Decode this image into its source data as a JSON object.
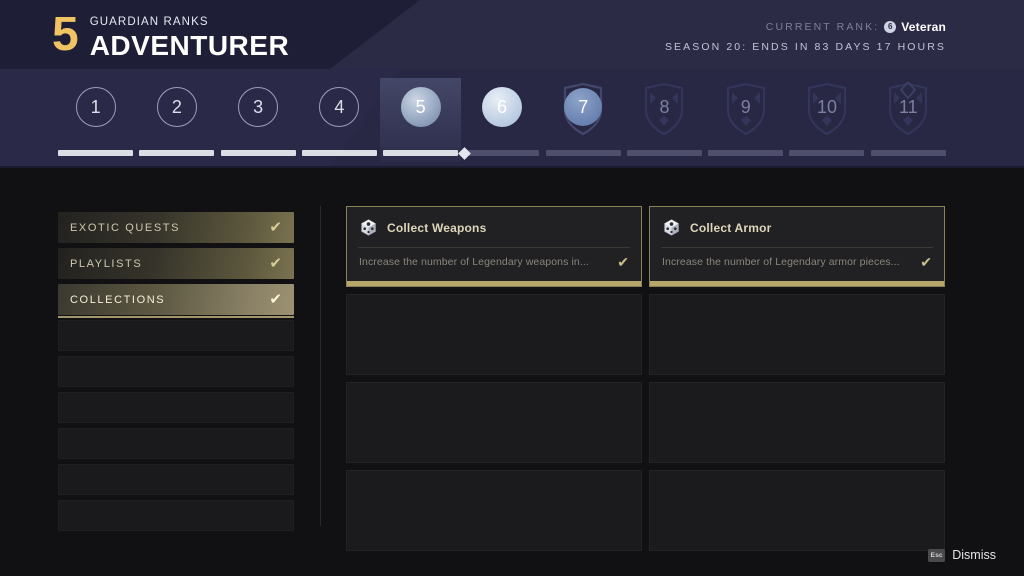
{
  "header": {
    "rank_number": "5",
    "subtitle": "GUARDIAN RANKS",
    "rank_name": "ADVENTURER",
    "current_rank_label": "CURRENT RANK:",
    "current_rank_badge": "6",
    "current_rank_value": "Veteran",
    "season_line": "SEASON 20: ENDS IN 83 DAYS 17 HOURS"
  },
  "rank_track": {
    "ranks": [
      {
        "label": "1",
        "style": "outline",
        "fill_pct": 100,
        "marker": false
      },
      {
        "label": "2",
        "style": "outline",
        "fill_pct": 100,
        "marker": false
      },
      {
        "label": "3",
        "style": "outline",
        "fill_pct": 100,
        "marker": false
      },
      {
        "label": "4",
        "style": "outline",
        "fill_pct": 100,
        "marker": false
      },
      {
        "label": "5",
        "style": "current",
        "fill_pct": 100,
        "marker": false
      },
      {
        "label": "6",
        "style": "attained",
        "fill_pct": 0,
        "marker": true
      },
      {
        "label": "7",
        "style": "crest-filled",
        "fill_pct": 0,
        "marker": false
      },
      {
        "label": "8",
        "style": "crest",
        "fill_pct": 0,
        "marker": false
      },
      {
        "label": "9",
        "style": "crest",
        "fill_pct": 0,
        "marker": false
      },
      {
        "label": "10",
        "style": "crest",
        "fill_pct": 0,
        "marker": false
      },
      {
        "label": "11",
        "style": "crest",
        "fill_pct": 0,
        "marker": false
      }
    ]
  },
  "sidebar": {
    "items": [
      {
        "label": "EXOTIC QUESTS",
        "selected": false,
        "check": "✔"
      },
      {
        "label": "PLAYLISTS",
        "selected": false,
        "check": "✔"
      },
      {
        "label": "COLLECTIONS",
        "selected": true,
        "check": "✔"
      }
    ],
    "empty_rows": 6
  },
  "cards": [
    {
      "title": "Collect Weapons",
      "description": "Increase the number of Legendary weapons in...",
      "check": "✔",
      "icon": "crystal-cube-icon",
      "progress_pct": 100
    },
    {
      "title": "Collect Armor",
      "description": "Increase the number of Legendary armor pieces...",
      "check": "✔",
      "icon": "crystal-cube-icon",
      "progress_pct": 100
    }
  ],
  "empty_card_rows": 3,
  "footer": {
    "key_glyph": "Esc",
    "dismiss_label": "Dismiss"
  },
  "colors": {
    "accent_gold": "#f0c462",
    "progress_gold": "#b7a76b",
    "header_navy": "#282845",
    "body_dark": "#111113"
  }
}
